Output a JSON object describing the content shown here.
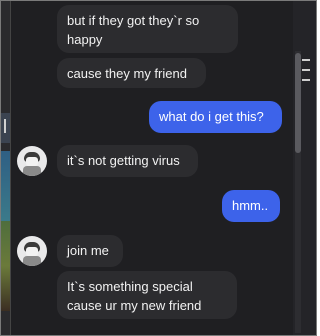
{
  "messages": [
    {
      "id": "m1",
      "direction": "incoming",
      "text": "but if they got they`r so\nhappy"
    },
    {
      "id": "m2",
      "direction": "incoming",
      "text": "cause they my friend"
    },
    {
      "id": "m3",
      "direction": "outgoing",
      "text": "what do i get this?"
    },
    {
      "id": "m4",
      "direction": "incoming",
      "text": "it`s not getting virus"
    },
    {
      "id": "m5",
      "direction": "outgoing",
      "text": "hmm.."
    },
    {
      "id": "m6",
      "direction": "incoming",
      "text": "join me"
    },
    {
      "id": "m7",
      "direction": "incoming",
      "text": "It`s something special\ncause ur my new friend"
    }
  ],
  "colors": {
    "outgoing_bubble": "#3d63ea",
    "incoming_bubble": "#2c2c2f",
    "background": "#1f1f22"
  },
  "icons": {
    "avatar": "contact-avatar-icon",
    "menu": "hamburger-menu-icon"
  }
}
